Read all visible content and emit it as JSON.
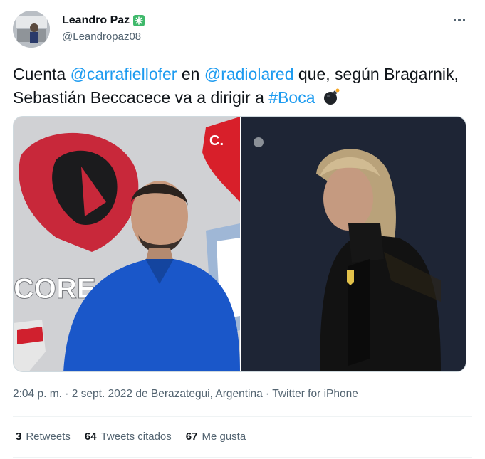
{
  "author": {
    "name": "Leandro Paz",
    "handle": "@Leandropaz08",
    "badge_icon": "sparkle-badge-icon"
  },
  "tweet": {
    "prefix": "Cuenta ",
    "mention1": "@carrafiellofer",
    "mid1": " en ",
    "mention2": "@radiolared",
    "mid2": " que, según Bragarnik, Sebastián Beccacece va a dirigir a ",
    "hashtag": "#Boca",
    "emoji_icon": "bomb-icon",
    "image_text": "CORE"
  },
  "meta": {
    "time": "2:04 p. m.",
    "sep1": " · ",
    "date": "2 sept. 2022",
    "location": " de Berazategui, Argentina",
    "sep2": " · ",
    "source": "Twitter for iPhone"
  },
  "stats": {
    "retweets_count": "3",
    "retweets_label": "Retweets",
    "quotes_count": "64",
    "quotes_label": "Tweets citados",
    "likes_count": "67",
    "likes_label": "Me gusta"
  },
  "colors": {
    "link": "#1d9bf0",
    "secondary_text": "#536471",
    "badge": "#3fb96b"
  }
}
